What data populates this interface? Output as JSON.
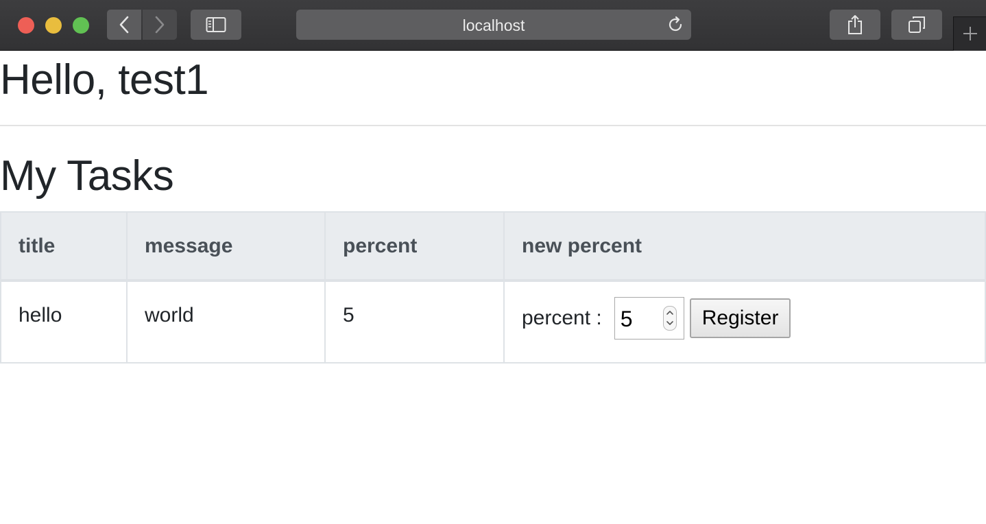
{
  "browser": {
    "address": "localhost",
    "icons": {
      "back": "chevron-left-icon",
      "forward": "chevron-right-icon",
      "sidebar": "sidebar-icon",
      "reload": "reload-icon",
      "share": "share-icon",
      "tabs": "tabs-icon",
      "new_tab": "plus-icon"
    }
  },
  "page": {
    "greeting": "Hello, test1",
    "section_title": "My Tasks"
  },
  "table": {
    "headers": [
      "title",
      "message",
      "percent",
      "new percent"
    ],
    "rows": [
      {
        "title": "hello",
        "message": "world",
        "percent": "5",
        "form": {
          "label": "percent :",
          "input_value": "5",
          "button_label": "Register"
        }
      }
    ]
  },
  "colors": {
    "header_bg": "#e9ecef",
    "header_text": "#495057",
    "border": "#dee2e6",
    "text": "#212529"
  }
}
